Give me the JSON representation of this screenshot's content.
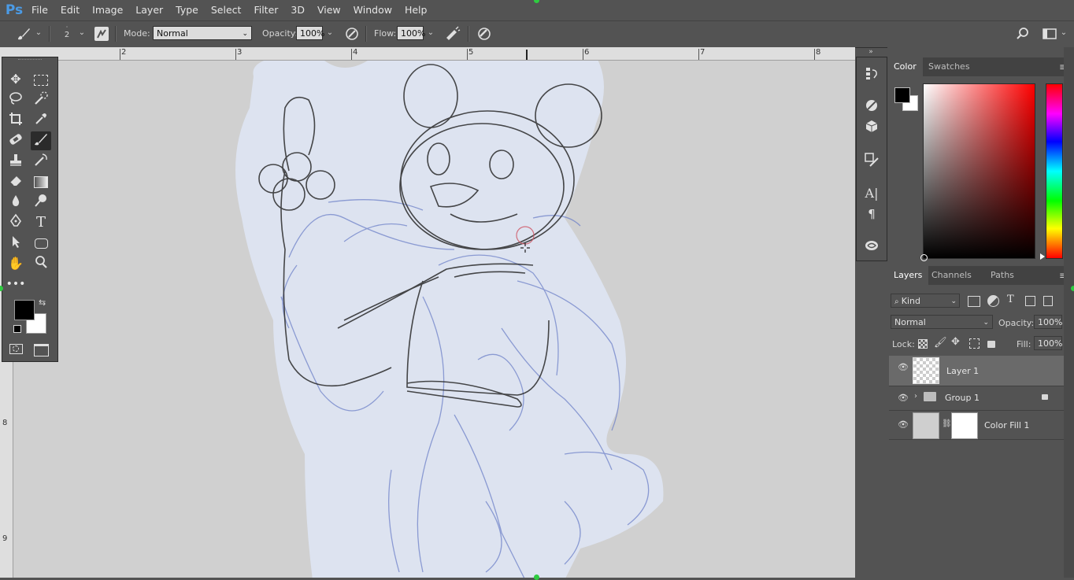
{
  "app": {
    "logo": "Ps"
  },
  "menu": [
    "File",
    "Edit",
    "Image",
    "Layer",
    "Type",
    "Select",
    "Filter",
    "3D",
    "View",
    "Window",
    "Help"
  ],
  "options": {
    "brush_size": "2",
    "mode_label": "Mode:",
    "mode_value": "Normal",
    "opacity_label": "Opacity:",
    "opacity_value": "100%",
    "flow_label": "Flow:",
    "flow_value": "100%"
  },
  "ruler": {
    "top_numbers": [
      "2",
      "3",
      "4",
      "5",
      "6",
      "7",
      "8"
    ],
    "left_numbers": [
      "8",
      "9"
    ]
  },
  "color_panel": {
    "tabs": [
      "Color",
      "Swatches"
    ],
    "active_tab": "Color",
    "foreground": "#000000",
    "background": "#ffffff",
    "hue": "#ff0000"
  },
  "layers_panel": {
    "tabs": [
      "Layers",
      "Channels",
      "Paths"
    ],
    "active_tab": "Layers",
    "filter_kind": "Kind",
    "blend_mode": "Normal",
    "opacity_label": "Opacity:",
    "opacity_value": "100%",
    "lock_label": "Lock:",
    "fill_label": "Fill:",
    "fill_value": "100%",
    "layers": [
      {
        "name": "Layer 1",
        "selected": true
      },
      {
        "name": "Group 1",
        "selected": false,
        "locked": true
      },
      {
        "name": "Color Fill 1",
        "selected": false
      }
    ]
  },
  "colors": {
    "ui_bg": "#535353",
    "panel_dark": "#424242",
    "canvas_bg": "#d0d0d0",
    "paper": "#dde3f0",
    "sketch_blue": "#6f82c9",
    "sketch_dark": "#2a2a2a",
    "selection": "#6a6a6a"
  }
}
